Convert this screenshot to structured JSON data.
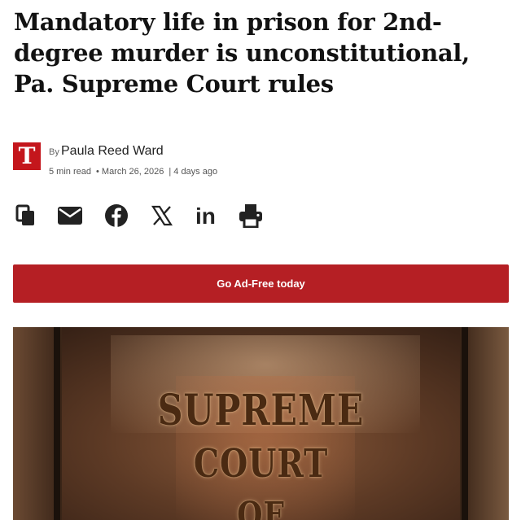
{
  "article": {
    "headline": "Mandatory life in prison for 2nd-degree murder is unconstitutional, Pa. Supreme Court rules",
    "publisher_logo_letter": "T",
    "by_prefix": "By",
    "author": "Paula Reed Ward",
    "read_time": "5 min read",
    "bullet": "•",
    "date": "March 26, 2026",
    "separator": "|",
    "relative_time": "4 days ago"
  },
  "share": {
    "icons": [
      "copy-icon",
      "email-icon",
      "facebook-icon",
      "x-icon",
      "linkedin-icon",
      "print-icon"
    ],
    "linkedin_text": "in"
  },
  "cta": {
    "label": "Go Ad-Free today",
    "color": "#b51f24"
  },
  "hero_image": {
    "sign_lines": [
      "SUPREME",
      "COURT",
      "OF"
    ]
  },
  "colors": {
    "brand_red": "#c4161c",
    "icon": "#222222"
  }
}
